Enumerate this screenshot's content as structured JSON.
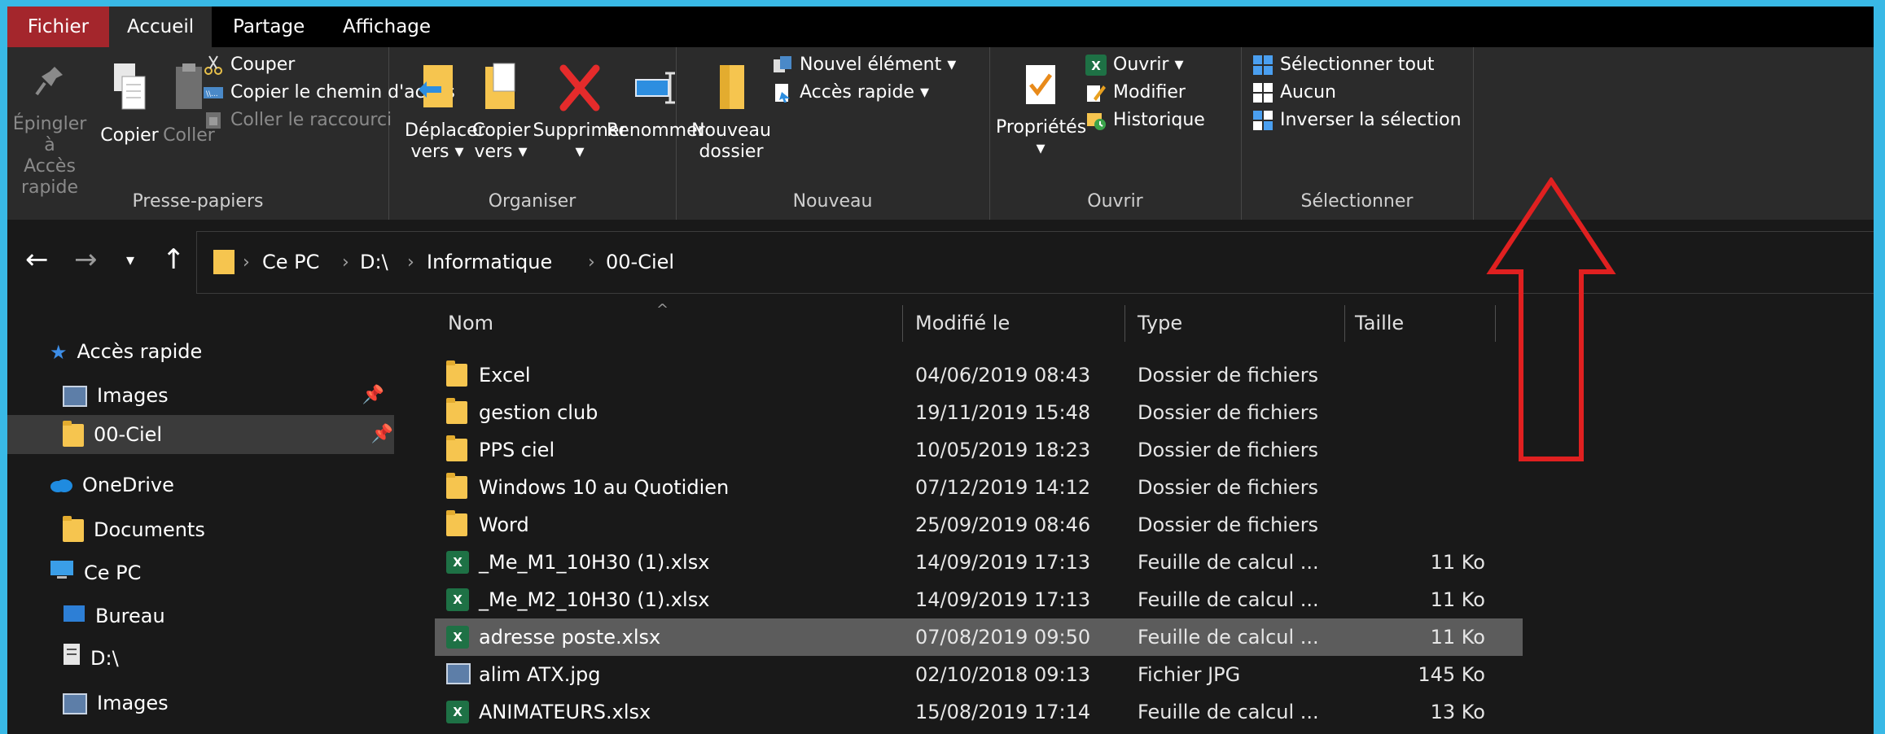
{
  "tabs": [
    "Fichier",
    "Accueil",
    "Partage",
    "Affichage"
  ],
  "ribbon": {
    "clipboard": {
      "pin_label_1": "Épingler à",
      "pin_label_2": "Accès rapide",
      "copy": "Copier",
      "paste": "Coller",
      "cut": "Couper",
      "copy_path": "Copier le chemin d'accès",
      "paste_shortcut": "Coller le raccourci",
      "group": "Presse-papiers"
    },
    "organize": {
      "move_1": "Déplacer",
      "move_2": "vers ▾",
      "copyto_1": "Copier",
      "copyto_2": "vers ▾",
      "delete": "Supprimer",
      "delete_arrow": "▾",
      "rename": "Renommer",
      "group": "Organiser"
    },
    "new": {
      "folder_1": "Nouveau",
      "folder_2": "dossier",
      "new_item": "Nouvel élément ▾",
      "quick_access": "Accès rapide ▾",
      "group": "Nouveau"
    },
    "open": {
      "properties": "Propriétés",
      "properties_arrow": "▾",
      "open": "Ouvrir ▾",
      "edit": "Modifier",
      "history": "Historique",
      "group": "Ouvrir"
    },
    "select": {
      "select_all": "Sélectionner tout",
      "none": "Aucun",
      "invert": "Inverser la sélection",
      "group": "Sélectionner"
    }
  },
  "address": {
    "crumbs": [
      "Ce PC",
      "D:\\",
      "Informatique",
      "00-Ciel"
    ]
  },
  "nav": {
    "quick_access": "Accès rapide",
    "images": "Images",
    "ciel": "00-Ciel",
    "onedrive": "OneDrive",
    "documents": "Documents",
    "cepc": "Ce PC",
    "bureau": "Bureau",
    "d": "D:\\",
    "images2": "Images"
  },
  "columns": {
    "name": "Nom",
    "modified": "Modifié le",
    "type": "Type",
    "size": "Taille"
  },
  "files": [
    {
      "name": "Excel",
      "date": "04/06/2019 08:43",
      "type": "Dossier de fichiers",
      "size": "",
      "icon": "folder"
    },
    {
      "name": "gestion club",
      "date": "19/11/2019 15:48",
      "type": "Dossier de fichiers",
      "size": "",
      "icon": "folder"
    },
    {
      "name": "PPS ciel",
      "date": "10/05/2019 18:23",
      "type": "Dossier de fichiers",
      "size": "",
      "icon": "folder"
    },
    {
      "name": "Windows 10 au Quotidien",
      "date": "07/12/2019 14:12",
      "type": "Dossier de fichiers",
      "size": "",
      "icon": "folder"
    },
    {
      "name": "Word",
      "date": "25/09/2019 08:46",
      "type": "Dossier de fichiers",
      "size": "",
      "icon": "folder"
    },
    {
      "name": "_Me_M1_10H30 (1).xlsx",
      "date": "14/09/2019 17:13",
      "type": "Feuille de calcul ...",
      "size": "11 Ko",
      "icon": "excel"
    },
    {
      "name": "_Me_M2_10H30 (1).xlsx",
      "date": "14/09/2019 17:13",
      "type": "Feuille de calcul ...",
      "size": "11 Ko",
      "icon": "excel"
    },
    {
      "name": "adresse poste.xlsx",
      "date": "07/08/2019 09:50",
      "type": "Feuille de calcul ...",
      "size": "11 Ko",
      "icon": "excel"
    },
    {
      "name": "alim ATX.jpg",
      "date": "02/10/2018 09:13",
      "type": "Fichier JPG",
      "size": "145 Ko",
      "icon": "image"
    },
    {
      "name": "ANIMATEURS.xlsx",
      "date": "15/08/2019 17:14",
      "type": "Feuille de calcul ...",
      "size": "13 Ko",
      "icon": "excel"
    }
  ],
  "colors": {
    "frame": "#39b9e6",
    "fichier_tab": "#a4262c",
    "ribbon_bg": "#2b2b2b",
    "window_bg": "#191919",
    "selected_row": "#5c5c5c",
    "annotation_arrow": "#e02020"
  }
}
